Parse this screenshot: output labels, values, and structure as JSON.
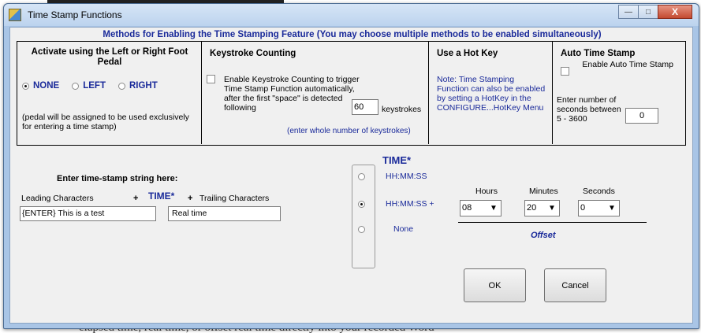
{
  "background": {
    "bottom_text": "elapsed time, real time, or offset real time directly into your recorded Word"
  },
  "window": {
    "title": "Time Stamp Functions",
    "controls": {
      "minimize": "—",
      "maximize": "□",
      "close": "X"
    }
  },
  "methods": {
    "title": "Methods for Enabling the Time Stamping Feature (You may choose multiple methods to be enabled simultaneously)",
    "foot_pedal": {
      "heading": "Activate using the Left or Right Foot Pedal",
      "options": [
        {
          "label": "NONE",
          "checked": true
        },
        {
          "label": "LEFT",
          "checked": false
        },
        {
          "label": "RIGHT",
          "checked": false
        }
      ],
      "note": "(pedal will be assigned to be used exclusively for entering a time stamp)"
    },
    "keystroke": {
      "heading": "Keystroke Counting",
      "checkbox_label": "Enable Keystroke Counting to trigger Time Stamp Function automatically, after the first \"space\" is detected following",
      "value": "60",
      "unit": "keystrokes",
      "hint": "(enter whole number of keystrokes)"
    },
    "hotkey": {
      "heading": "Use a Hot Key",
      "note": "Note: Time Stamping Function can also be enabled by setting a HotKey in the CONFIGURE...HotKey Menu"
    },
    "auto": {
      "heading": "Auto Time Stamp",
      "checkbox_label": "Enable Auto Time Stamp",
      "seconds_label": "Enter number of seconds between 5 - 3600",
      "value": "0"
    }
  },
  "stamp_string": {
    "label": "Enter time-stamp string here:",
    "leading_label": "Leading Characters",
    "plus": "+",
    "time_token": "TIME*",
    "trailing_label": "Trailing Characters",
    "leading_value": "{ENTER} This is a test",
    "trailing_value": "Real time"
  },
  "time_format": {
    "heading": "TIME*",
    "options": [
      {
        "label": "HH:MM:SS",
        "checked": false
      },
      {
        "label": "HH:MM:SS +",
        "checked": true
      },
      {
        "label": "None",
        "checked": false
      }
    ]
  },
  "offset": {
    "hours_label": "Hours",
    "minutes_label": "Minutes",
    "seconds_label": "Seconds",
    "hours_value": "08",
    "minutes_value": "20",
    "seconds_value": "0",
    "label": "Offset"
  },
  "buttons": {
    "ok": "OK",
    "cancel": "Cancel"
  },
  "colors": {
    "accent_blue": "#1a2a9a",
    "client_bg": "#f0f0f0",
    "frame": "#a9c5e6"
  }
}
